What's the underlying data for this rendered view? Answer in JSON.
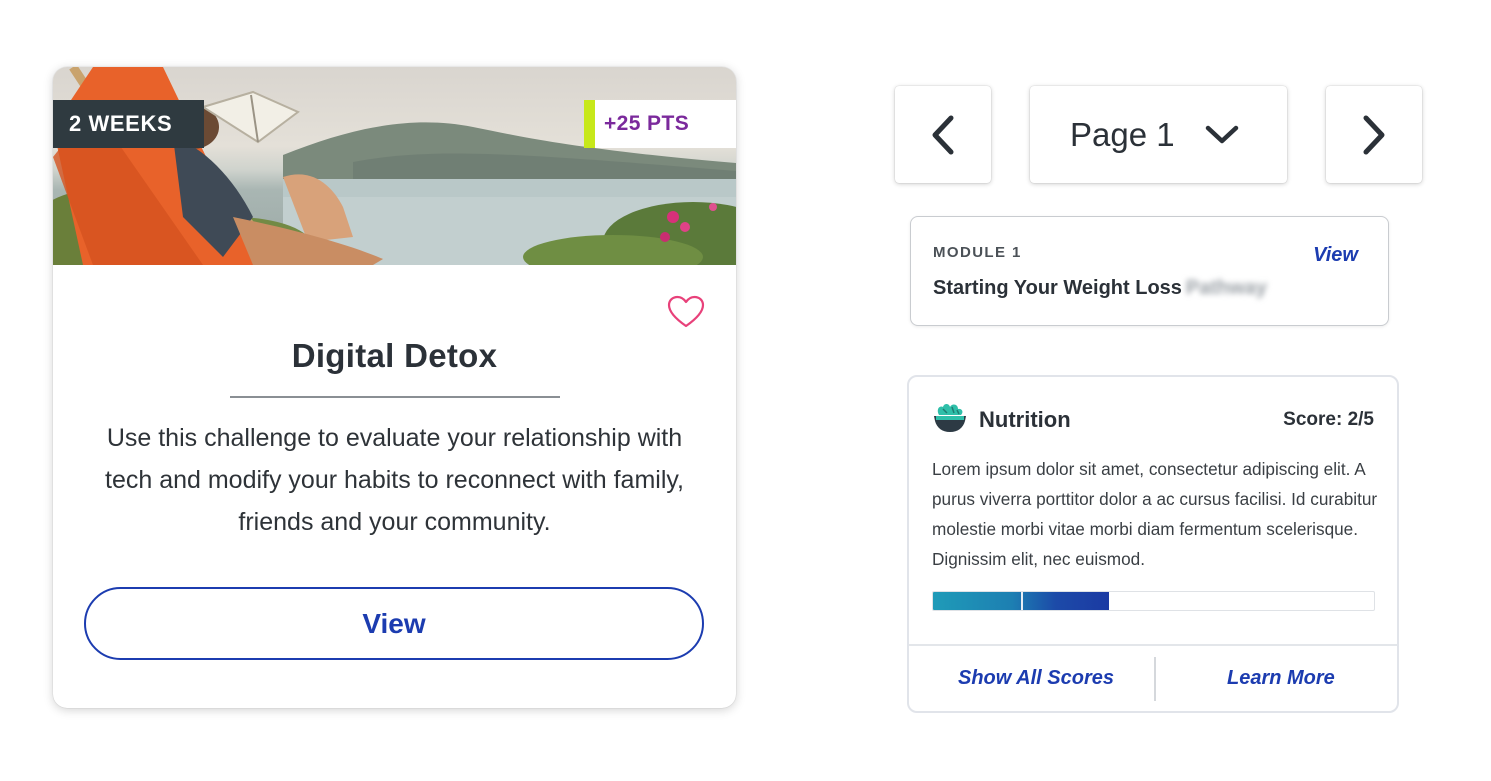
{
  "challenge_card": {
    "duration_badge": "2 WEEKS",
    "points_badge": "+25 PTS",
    "title": "Digital Detox",
    "description": "Use this challenge to evaluate your relationship with tech and modify your habits to reconnect with family, friends and your community.",
    "view_label": "View",
    "favorite_icon": "heart-outline-icon",
    "colors": {
      "points_accent": "#c7e81a",
      "points_text": "#7b2a9c",
      "button": "#1c3cb0",
      "favorite": "#e8417a"
    }
  },
  "pagination": {
    "prev_icon": "chevron-left-icon",
    "page_label": "Page 1",
    "dropdown_icon": "chevron-down-icon",
    "next_icon": "chevron-right-icon"
  },
  "module_card": {
    "eyebrow": "MODULE 1",
    "title": "Starting Your Weight Loss",
    "title_blurred": "Pathway",
    "view_label": "View"
  },
  "nutrition_card": {
    "icon": "salad-bowl-icon",
    "title": "Nutrition",
    "score_label": "Score: 2/5",
    "score": 2,
    "score_max": 5,
    "description": "Lorem ipsum dolor sit amet, consectetur adipiscing elit. A purus viverra porttitor dolor a ac cursus facilisi. Id curabitur molestie morbi vitae morbi diam fermentum scelerisque. Dignissim elit, nec euismod.",
    "show_all_label": "Show All Scores",
    "learn_more_label": "Learn More"
  }
}
